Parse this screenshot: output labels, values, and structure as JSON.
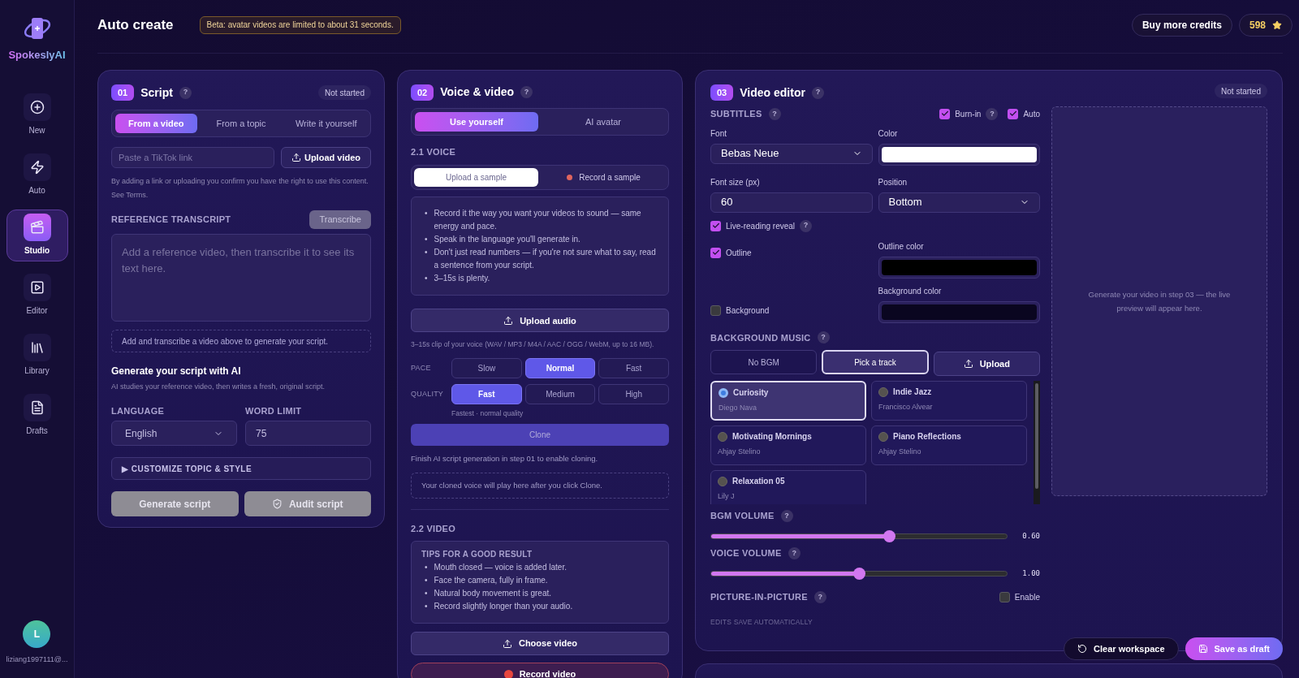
{
  "sidebar": {
    "logo_text": "SpokeslyAI",
    "items": [
      {
        "label": "New",
        "kind": "new",
        "selected": false
      },
      {
        "label": "Auto",
        "kind": "auto",
        "selected": false
      },
      {
        "label": "Studio",
        "kind": "studio",
        "selected": true
      },
      {
        "label": "Editor",
        "kind": "editor",
        "selected": false
      },
      {
        "label": "Library",
        "kind": "library",
        "selected": false
      },
      {
        "label": "Drafts",
        "kind": "drafts",
        "selected": false
      }
    ],
    "user": {
      "initial": "L",
      "email": "liziang1997111@..."
    }
  },
  "header": {
    "title": "Auto create",
    "notice": "Beta: avatar videos are limited to about 31 seconds.",
    "buy_button": "Buy more credits",
    "credits": "598"
  },
  "script": {
    "step": "01",
    "title": "Script",
    "help": "?",
    "status": "Not started",
    "tabs": [
      {
        "label": "From a video",
        "selected": true
      },
      {
        "label": "From a topic",
        "selected": false
      },
      {
        "label": "Write it yourself",
        "selected": false
      }
    ],
    "link_placeholder": "Paste a TikTok link",
    "upload_button": "Upload video",
    "consent": "By adding a link or uploading you confirm you have the right to use this content. See Terms.",
    "transcript_label": "REFERENCE TRANSCRIPT",
    "transcribe_button": "Transcribe",
    "transcript_placeholder": "Add a reference video, then transcribe it to see its text here.",
    "hint": "Add and transcribe a video above to generate your script.",
    "generate_title": "Generate your script with AI",
    "generate_desc": "AI studies your reference video, then writes a fresh, original script.",
    "language_label": "LANGUAGE",
    "language_value": "English",
    "word_limit_label": "WORD LIMIT",
    "word_limit_value": "75",
    "customize": {
      "marker": "▶",
      "label": "CUSTOMIZE TOPIC & STYLE"
    },
    "buttons": [
      {
        "label": "Generate script",
        "kind": "generate",
        "disabled": true
      },
      {
        "label": "Audit script",
        "kind": "audit",
        "disabled": true
      }
    ]
  },
  "voice": {
    "step": "02",
    "title": "Voice & video",
    "help": "?",
    "mode_tabs": [
      {
        "label": "Use yourself",
        "selected": true
      },
      {
        "label": "AI avatar",
        "selected": false
      }
    ],
    "voice_heading": "2.1 VOICE",
    "sample_tabs": [
      {
        "label": "Upload a sample",
        "kind": "upload",
        "selected": true
      },
      {
        "label": "Record a sample",
        "kind": "record",
        "selected": false
      }
    ],
    "bullet": "•",
    "tips": [
      "Record it the way you want your videos to sound — same energy and pace.",
      "Speak in the language you'll generate in.",
      "Don't just read numbers — if you're not sure what to say, read a sentence from your script.",
      "3–15s is plenty."
    ],
    "upload_audio": "Upload audio",
    "format_note": "3–15s clip of your voice (WAV / MP3 / M4A / AAC / OGG / WebM, up to 16 MB).",
    "pace": {
      "label": "PACE",
      "options": [
        {
          "label": "Slow",
          "selected": false
        },
        {
          "label": "Normal",
          "selected": true
        },
        {
          "label": "Fast",
          "selected": false
        }
      ]
    },
    "quality": {
      "label": "QUALITY",
      "options": [
        {
          "label": "Fast",
          "selected": true
        },
        {
          "label": "Medium",
          "selected": false
        },
        {
          "label": "High",
          "selected": false
        }
      ]
    },
    "quality_note": "Fastest · normal quality",
    "clone_button": "Clone",
    "clone_note": "Finish AI script generation in step 01 to enable cloning.",
    "clone_placeholder": "Your cloned voice will play here after you click Clone.",
    "video_heading": "2.2 VIDEO",
    "video_tips": {
      "title": "TIPS FOR A GOOD RESULT",
      "bullet": "•",
      "items": [
        "Mouth closed — voice is added later.",
        "Face the camera, fully in frame.",
        "Natural body movement is great.",
        "Record slightly longer than your audio."
      ]
    },
    "choose_video": "Choose video",
    "record_video": "Record video"
  },
  "editor": {
    "step": "03",
    "title": "Video editor",
    "help": "?",
    "status": "Not started",
    "subtitles": {
      "heading": "SUBTITLES",
      "help": "?",
      "burn_in": {
        "label": "Burn-in",
        "help": "?",
        "checked": true
      },
      "auto": {
        "label": "Auto",
        "checked": true
      },
      "font_label": "Font",
      "font_value": "Bebas Neue",
      "color_label": "Color",
      "size_label": "Font size (px)",
      "size_value": "60",
      "position_label": "Position",
      "position_value": "Bottom",
      "live_reading": {
        "label": "Live-reading reveal",
        "help": "?",
        "checked": true
      },
      "outline": {
        "label": "Outline",
        "checked": true
      },
      "outline_color_label": "Outline color",
      "background": {
        "label": "Background",
        "checked": false
      },
      "background_color_label": "Background color"
    },
    "music": {
      "heading": "BACKGROUND MUSIC",
      "help": "?",
      "options": [
        {
          "label": "No BGM",
          "kind": "choice",
          "selected": false
        },
        {
          "label": "Pick a track",
          "kind": "choice",
          "selected": true
        },
        {
          "label": "Upload",
          "kind": "upload",
          "selected": false
        }
      ],
      "tracks": [
        {
          "title": "Curiosity",
          "artist": "Diego Nava",
          "selected": true
        },
        {
          "title": "Indie Jazz",
          "artist": "Francisco Alvear",
          "selected": false
        },
        {
          "title": "Motivating Mornings",
          "artist": "Ahjay Stelino",
          "selected": false
        },
        {
          "title": "Piano Reflections",
          "artist": "Ahjay Stelino",
          "selected": false
        },
        {
          "title": "Relaxation 05",
          "artist": "Lily J",
          "selected": false
        }
      ]
    },
    "bgm_volume": {
      "label": "BGM VOLUME",
      "help": "?",
      "level": 0.6,
      "reading": "0.60"
    },
    "voice_volume": {
      "label": "VOICE VOLUME",
      "help": "?",
      "level": 0.5,
      "reading": "1.00"
    },
    "pip": {
      "label": "PICTURE-IN-PICTURE",
      "help": "?",
      "enable_label": "Enable",
      "checked": false
    },
    "autosave": "EDITS SAVE AUTOMATICALLY",
    "preview_text": "Generate your video in step 03 — the live preview will appear here."
  },
  "footer": {
    "clear_button": "Clear workspace",
    "save_button": "Save as draft"
  }
}
